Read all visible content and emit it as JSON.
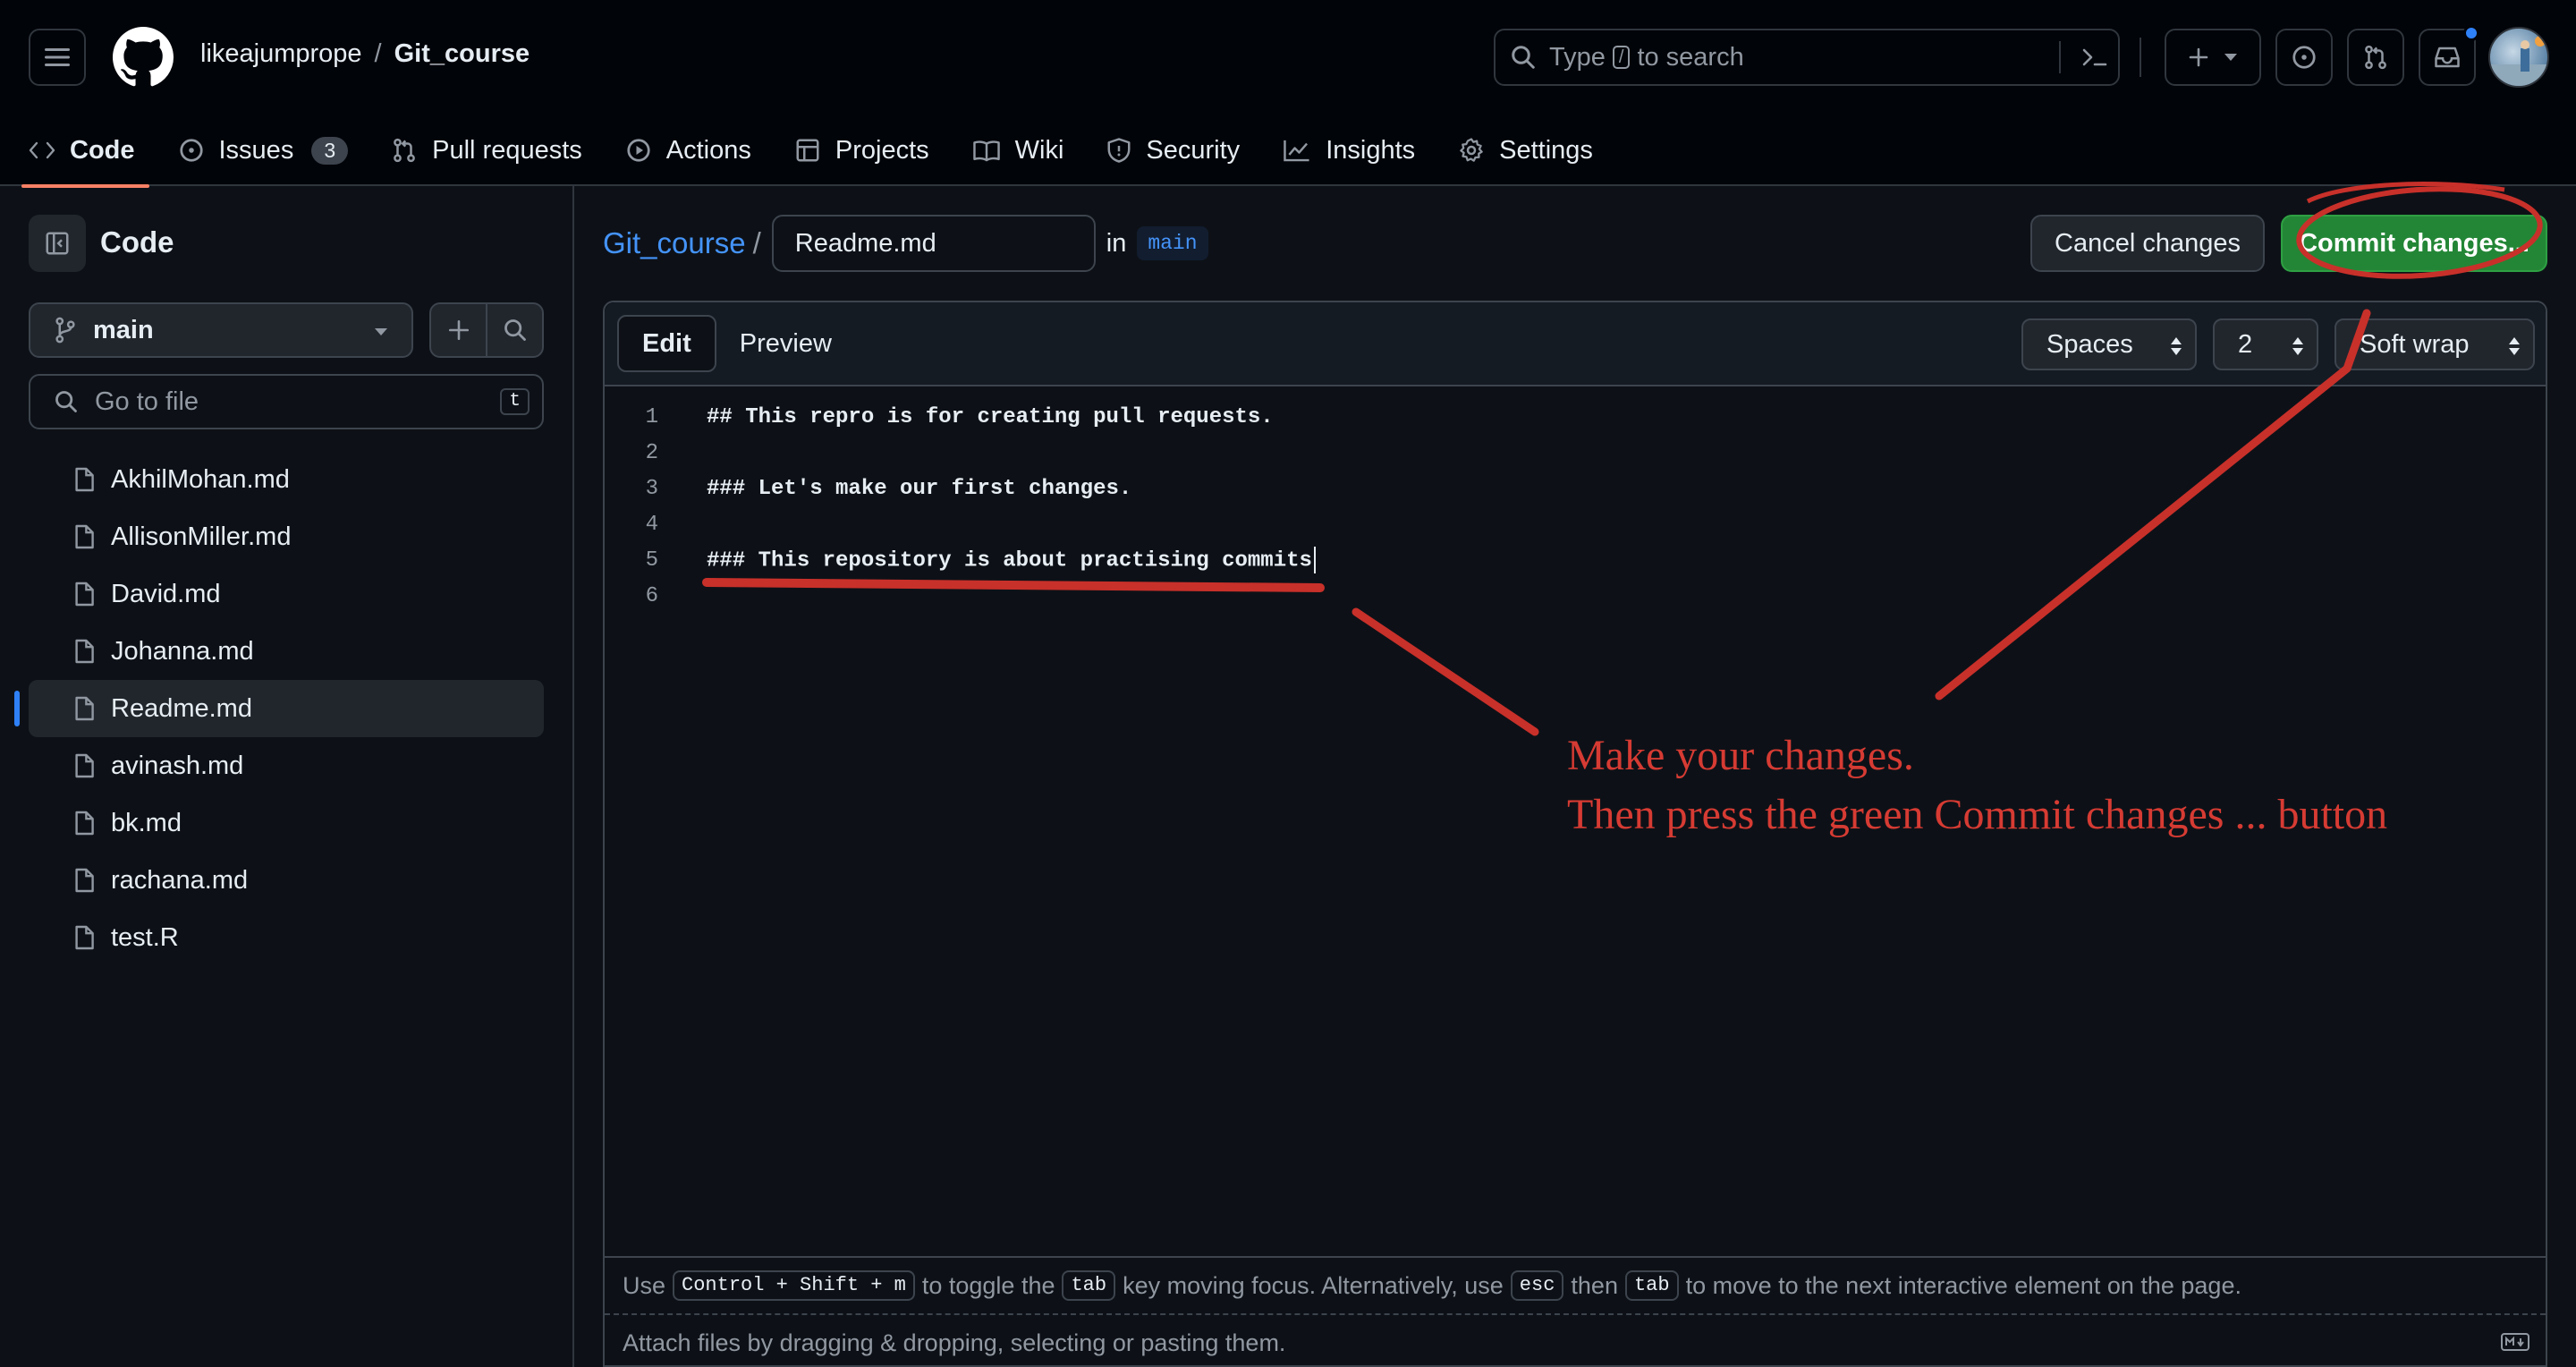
{
  "header": {
    "owner": "likeajumprope",
    "separator": "/",
    "repo": "Git_course",
    "search": {
      "prefix": "Type",
      "key": "/",
      "suffix": "to search"
    }
  },
  "nav": {
    "items": [
      {
        "label": "Code",
        "icon": "code-icon",
        "active": true
      },
      {
        "label": "Issues",
        "icon": "issue-icon",
        "count": "3"
      },
      {
        "label": "Pull requests",
        "icon": "pull-request-icon"
      },
      {
        "label": "Actions",
        "icon": "play-icon"
      },
      {
        "label": "Projects",
        "icon": "table-icon"
      },
      {
        "label": "Wiki",
        "icon": "book-icon"
      },
      {
        "label": "Security",
        "icon": "shield-icon"
      },
      {
        "label": "Insights",
        "icon": "graph-icon"
      },
      {
        "label": "Settings",
        "icon": "gear-icon"
      }
    ]
  },
  "sidebar": {
    "title": "Code",
    "branch": "main",
    "goto_placeholder": "Go to file",
    "goto_key": "t",
    "files": [
      {
        "name": "AkhilMohan.md"
      },
      {
        "name": "AllisonMiller.md"
      },
      {
        "name": "David.md"
      },
      {
        "name": "Johanna.md"
      },
      {
        "name": "Readme.md",
        "active": true
      },
      {
        "name": "avinash.md"
      },
      {
        "name": "bk.md"
      },
      {
        "name": "rachana.md"
      },
      {
        "name": "test.R"
      }
    ]
  },
  "editor": {
    "repo_link": "Git_course",
    "slash": "/",
    "filename": "Readme.md",
    "in_label": "in",
    "branch": "main",
    "cancel_label": "Cancel changes",
    "commit_label": "Commit changes...",
    "tabs": {
      "edit": "Edit",
      "preview": "Preview"
    },
    "indent_mode": "Spaces",
    "indent_size": "2",
    "wrap_mode": "Soft wrap",
    "lines": [
      {
        "num": "1",
        "text": "## This repro is for creating pull requests."
      },
      {
        "num": "2",
        "text": ""
      },
      {
        "num": "3",
        "text": "### Let's make our first changes."
      },
      {
        "num": "4",
        "text": ""
      },
      {
        "num": "5",
        "text": "### This repository is about practising commits"
      },
      {
        "num": "6",
        "text": ""
      }
    ],
    "hint": {
      "use": "Use",
      "keys1": "Control + Shift + m",
      "toggle": "to toggle the",
      "tab_key": "tab",
      "moving": "key moving focus. Alternatively, use",
      "esc_key": "esc",
      "then": "then",
      "tab_key2": "tab",
      "rest": "to move to the next interactive element on the page."
    },
    "attach_text": "Attach files by dragging & dropping, selecting or pasting them."
  },
  "annotation": {
    "line1": "Make your changes.",
    "line2": "Then press the green Commit changes ... button",
    "color": "#d63b33"
  },
  "colors": {
    "background": "#0d1117",
    "header_bg": "#010409",
    "accent_blue": "#4493f8",
    "commit_green": "#238636",
    "nav_underline": "#f78166"
  }
}
